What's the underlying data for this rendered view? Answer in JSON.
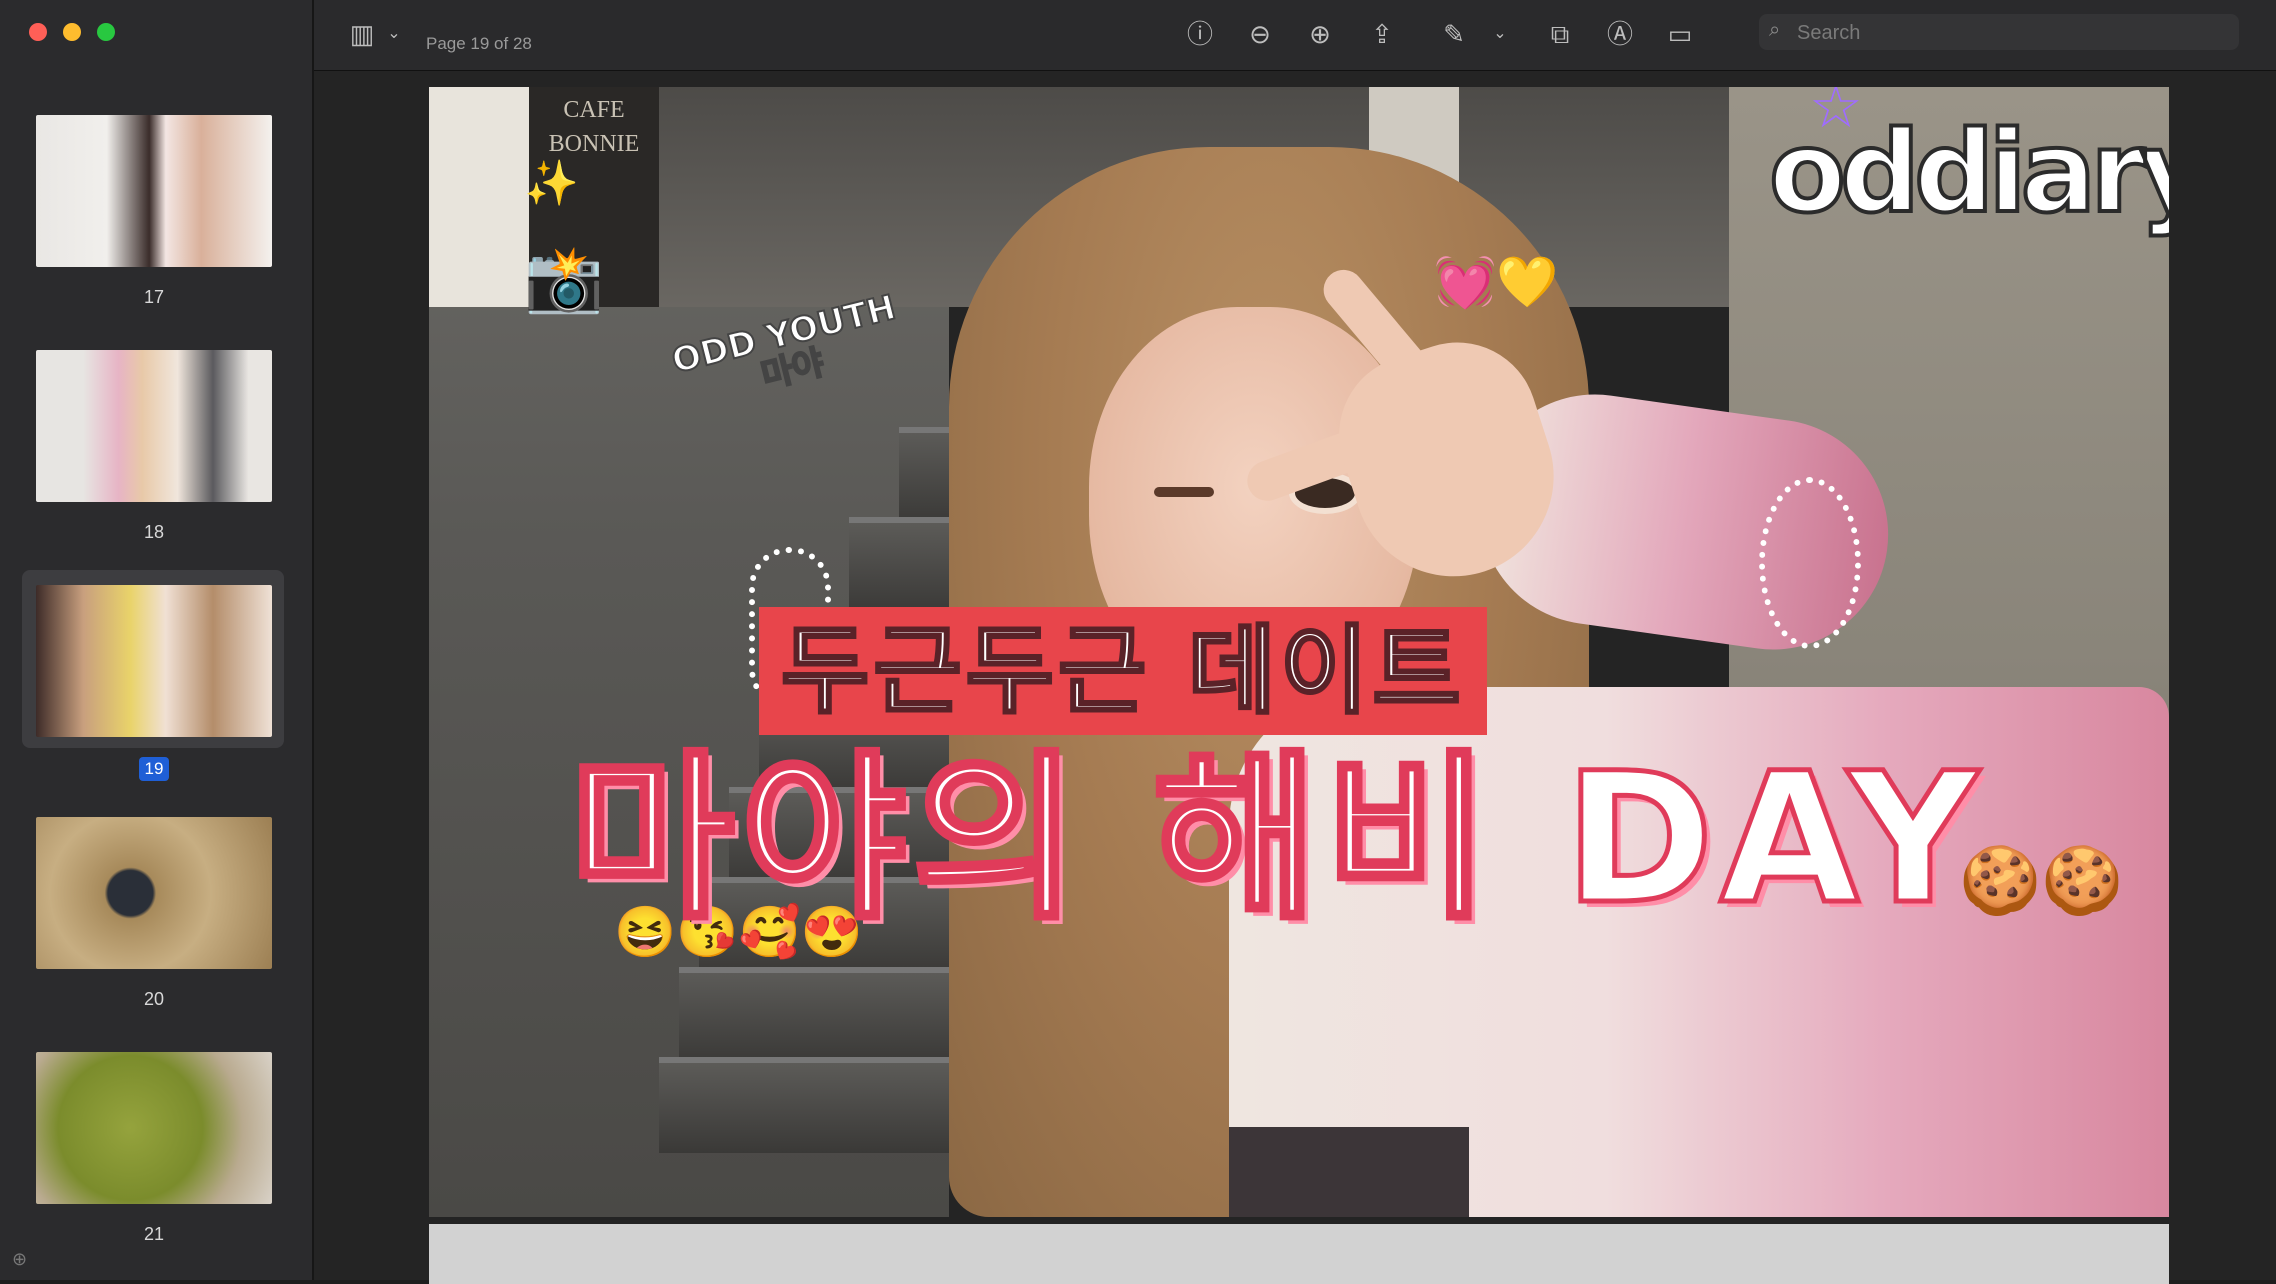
{
  "window": {
    "traffic_lights": {
      "close": "#ff5f57",
      "minimize": "#febc2e",
      "zoom": "#28c840"
    }
  },
  "toolbar": {
    "page_label": "Page 19 of 28",
    "search_placeholder": "Search",
    "icons": [
      "sidebar-toggle-icon",
      "chevron-down-icon",
      "info-icon",
      "zoom-out-icon",
      "zoom-in-icon",
      "share-icon",
      "markup-pen-icon",
      "chevron-down-icon",
      "rotate-icon",
      "highlight-icon",
      "form-fill-icon",
      "search-icon"
    ]
  },
  "sidebar": {
    "thumbnails": [
      {
        "page": "17",
        "selected": false
      },
      {
        "page": "18",
        "selected": false
      },
      {
        "page": "19",
        "selected": true
      },
      {
        "page": "20",
        "selected": false
      },
      {
        "page": "21",
        "selected": false
      }
    ]
  },
  "document": {
    "logo_text": "oddiary",
    "sign_text": [
      "CAFE",
      "BONNIE"
    ],
    "tag_text_line1": "ODD YOUTH",
    "tag_text_line2": "마야",
    "subtitle": "두근두근 데이트",
    "title": "마야의 해비 DAY",
    "emoji_row": "😆😘🥰😍",
    "camera_emoji": "📸",
    "sparkle_emoji": "✨",
    "heart_emojis": "💓💛",
    "cookie_emoji": "🍪🍪"
  },
  "colors": {
    "accent_red": "#e8454b",
    "title_stroke": "#e03b5a",
    "selection_badge": "#1f5fd6"
  }
}
